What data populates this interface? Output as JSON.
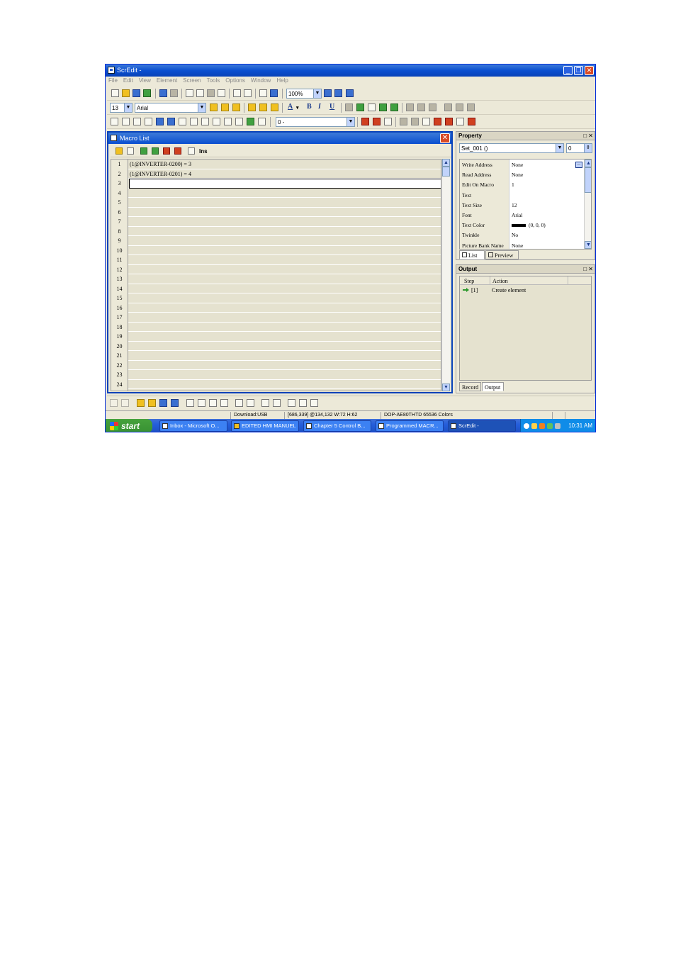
{
  "window": {
    "title": "ScrEdit -",
    "menu": [
      "File",
      "Edit",
      "View",
      "Element",
      "Screen",
      "Tools",
      "Options",
      "Window",
      "Help"
    ]
  },
  "toolbar": {
    "zoom": "100%",
    "font_size": "13",
    "font_name": "Arial",
    "screen_combo": "0 -",
    "bold": "B",
    "italic": "I",
    "underline": "U",
    "font_color": "A"
  },
  "macro_window": {
    "title": "Macro List",
    "ins_label": "Ins",
    "rows": [
      {
        "num": "1",
        "text": "(1@INVERTER-0200) = 3"
      },
      {
        "num": "2",
        "text": "(1@INVERTER-0201) = 4"
      },
      {
        "num": "3",
        "text": ""
      },
      {
        "num": "4",
        "text": ""
      },
      {
        "num": "5",
        "text": ""
      },
      {
        "num": "6",
        "text": ""
      },
      {
        "num": "7",
        "text": ""
      },
      {
        "num": "8",
        "text": ""
      },
      {
        "num": "9",
        "text": ""
      },
      {
        "num": "10",
        "text": ""
      },
      {
        "num": "11",
        "text": ""
      },
      {
        "num": "12",
        "text": ""
      },
      {
        "num": "13",
        "text": ""
      },
      {
        "num": "14",
        "text": ""
      },
      {
        "num": "15",
        "text": ""
      },
      {
        "num": "16",
        "text": ""
      },
      {
        "num": "17",
        "text": ""
      },
      {
        "num": "18",
        "text": ""
      },
      {
        "num": "19",
        "text": ""
      },
      {
        "num": "20",
        "text": ""
      },
      {
        "num": "21",
        "text": ""
      },
      {
        "num": "22",
        "text": ""
      },
      {
        "num": "23",
        "text": ""
      },
      {
        "num": "24",
        "text": ""
      }
    ]
  },
  "property_panel": {
    "title": "Property",
    "object_select": "Set_001 ()",
    "index_value": "0",
    "rows": [
      {
        "key": "Write Address",
        "value": "None"
      },
      {
        "key": "Read Address",
        "value": "None"
      },
      {
        "key": "Edit On Macro",
        "value": "1"
      },
      {
        "key": "Text",
        "value": ""
      },
      {
        "key": "Text Size",
        "value": "12"
      },
      {
        "key": "Font",
        "value": "Arial"
      },
      {
        "key": "Text Color",
        "value": "(0, 0, 0)"
      },
      {
        "key": "Twinkle",
        "value": "No"
      },
      {
        "key": "Picture Bank Name",
        "value": "None"
      }
    ],
    "tabs": [
      "List",
      "Preview"
    ]
  },
  "output_panel": {
    "title": "Output",
    "columns": [
      "Step",
      "Action"
    ],
    "rows": [
      {
        "step": "[1]",
        "action": "Create element"
      }
    ],
    "tabs": [
      "Record",
      "Output"
    ]
  },
  "status_bar": {
    "download": "Download:USB",
    "coords": "[686,339] @134,132 W:72 H:62",
    "model": "DOP-AE80THTD 65536 Colors"
  },
  "taskbar": {
    "start": "start",
    "items": [
      "Inbox - Microsoft O...",
      "EDITED HMI MANUEL",
      "Chapter 5 Control B...",
      "Programmed MACR...",
      "ScrEdit -"
    ],
    "clock": "10:31 AM"
  },
  "colors": {
    "title_blue": "#0a4fd0",
    "close_red": "#d84a25",
    "taskbar_blue": "#245edb",
    "start_green": "#379032",
    "face": "#ece9d8"
  }
}
